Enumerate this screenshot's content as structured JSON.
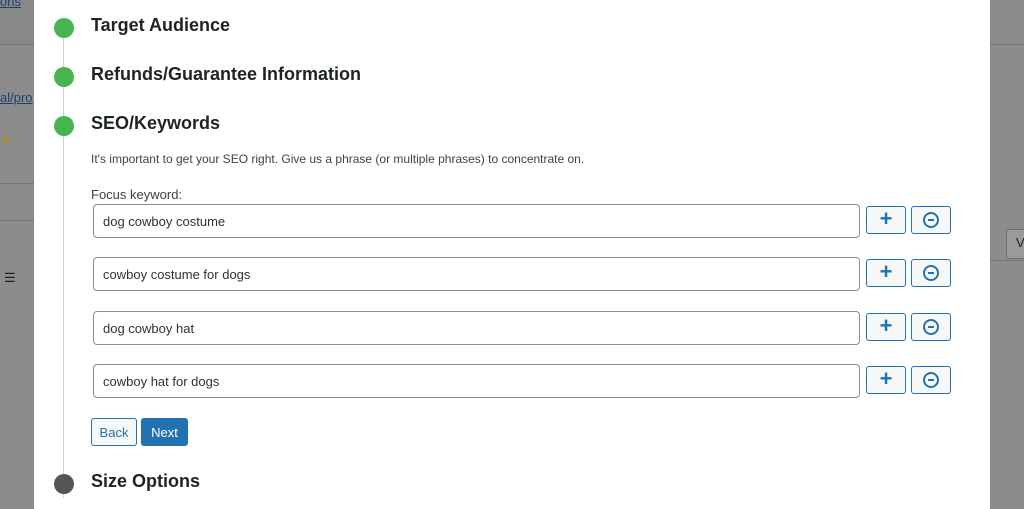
{
  "background": {
    "link_top": "ons",
    "link_mid": "al/pro",
    "right_field_text": "V"
  },
  "steps": [
    {
      "title": "Target Audience",
      "status": "complete"
    },
    {
      "title": "Refunds/Guarantee Information",
      "status": "complete"
    },
    {
      "title": "SEO/Keywords",
      "status": "complete"
    },
    {
      "title": "Size Options",
      "status": "pending"
    }
  ],
  "seo": {
    "description": "It's important to get your SEO right. Give us a phrase (or multiple phrases) to concentrate on.",
    "focus_label": "Focus keyword:",
    "keywords": [
      "dog cowboy costume",
      "cowboy costume for dogs",
      "dog cowboy hat",
      "cowboy hat for dogs"
    ],
    "add_icon": "plus-icon",
    "remove_icon": "minus-circle-icon"
  },
  "buttons": {
    "back": "Back",
    "next": "Next"
  },
  "colors": {
    "complete": "#46b450",
    "pending": "#555555",
    "accent": "#2271b1"
  }
}
